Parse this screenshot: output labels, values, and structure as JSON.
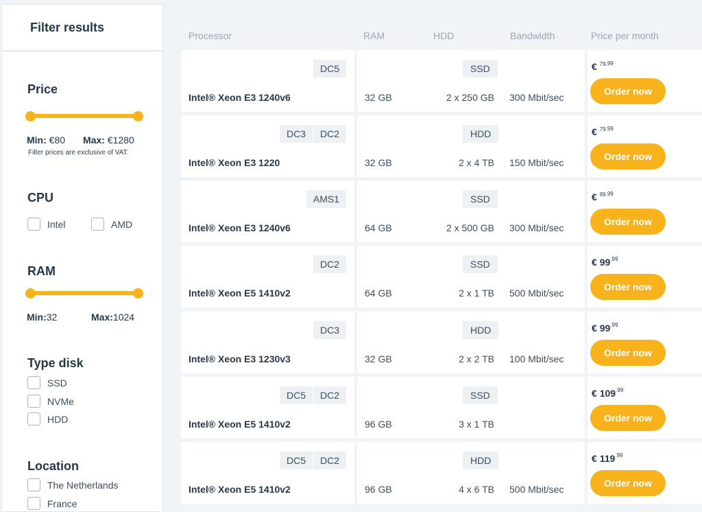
{
  "sidebar": {
    "title": "Filter results",
    "price": {
      "title": "Price",
      "min_label": "Min:",
      "min_value": "€80",
      "max_label": "Max:",
      "max_value": "€1280",
      "note": "Filter prices are exclusive of VAT."
    },
    "cpu": {
      "title": "CPU",
      "options": [
        "Intel",
        "AMD"
      ]
    },
    "ram": {
      "title": "RAM",
      "min_label": "Min:",
      "min_value": "32",
      "max_label": "Max:",
      "max_value": "1024"
    },
    "disk": {
      "title": "Type disk",
      "options": [
        "SSD",
        "NVMe",
        "HDD"
      ]
    },
    "location": {
      "title": "Location",
      "options": [
        "The Netherlands",
        "France"
      ]
    }
  },
  "table": {
    "headers": {
      "processor": "Processor",
      "ram": "RAM",
      "hdd": "HDD",
      "bandwidth": "Bandwidth",
      "price": "Price per month"
    },
    "order_label": "Order now",
    "rows": [
      {
        "tags": [
          "DC5"
        ],
        "processor": "Intel® Xeon E3 1240v6",
        "ram": "32 GB",
        "disk_type": "SSD",
        "hdd": "2 x 250 GB",
        "bandwidth": "300 Mbit/sec",
        "currency": "€",
        "price_main": "79",
        "price_cents": ".99"
      },
      {
        "tags": [
          "DC3",
          "DC2"
        ],
        "processor": "Intel® Xeon E3 1220",
        "ram": "32 GB",
        "disk_type": "HDD",
        "hdd": "2 x 4 TB",
        "bandwidth": "150 Mbit/sec",
        "currency": "€",
        "price_main": "79",
        "price_cents": ".99"
      },
      {
        "tags": [
          "AMS1"
        ],
        "processor": "Intel® Xeon E3 1240v6",
        "ram": "64 GB",
        "disk_type": "SSD",
        "hdd": "2 x 500 GB",
        "bandwidth": "300 Mbit/sec",
        "currency": "€",
        "price_main": "89",
        "price_cents": ".99"
      },
      {
        "tags": [
          "DC2"
        ],
        "processor": "Intel® Xeon E5 1410v2",
        "ram": "64 GB",
        "disk_type": "SSD",
        "hdd": "2 x 1 TB",
        "bandwidth": "500 Mbit/sec",
        "currency": "€",
        "price_main": "99",
        "price_cents": ".99"
      },
      {
        "tags": [
          "DC3"
        ],
        "processor": "Intel® Xeon E3 1230v3",
        "ram": "32 GB",
        "disk_type": "HDD",
        "hdd": "2 x 2 TB",
        "bandwidth": "100 Mbit/sec",
        "currency": "€",
        "price_main": "99",
        "price_cents": ".99"
      },
      {
        "tags": [
          "DC5",
          "DC2"
        ],
        "processor": "Intel® Xeon E5 1410v2",
        "ram": "96 GB",
        "disk_type": "SSD",
        "hdd": "3 x 1 TB",
        "bandwidth": "",
        "currency": "€",
        "price_main": "109",
        "price_cents": ".99"
      },
      {
        "tags": [
          "DC5",
          "DC2"
        ],
        "processor": "Intel® Xeon E5 1410v2",
        "ram": "96 GB",
        "disk_type": "HDD",
        "hdd": "4 x 6 TB",
        "bandwidth": "500 Mbit/sec",
        "currency": "€",
        "price_main": "119",
        "price_cents": ".99"
      }
    ]
  },
  "colors": {
    "accent": "#f8b21c",
    "background": "#f1f4f7",
    "text": "#25374a"
  },
  "filters": {
    "price_range": [
      0,
      1
    ],
    "ram_range": [
      0,
      1
    ]
  }
}
